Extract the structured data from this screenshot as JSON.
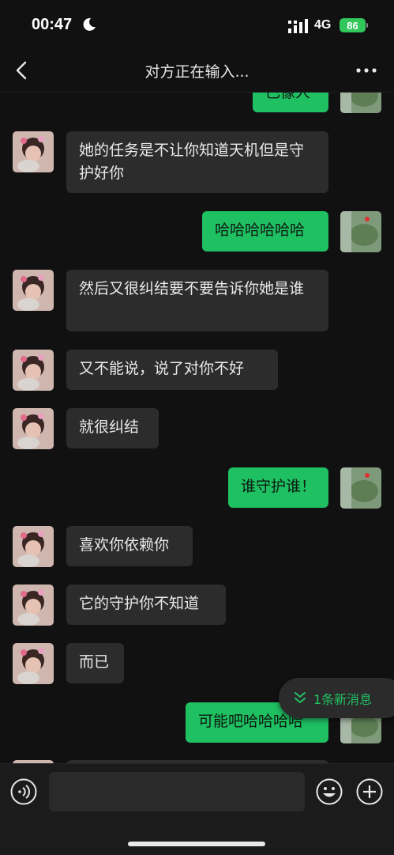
{
  "status": {
    "time": "00:47",
    "network": "4G",
    "battery": "86"
  },
  "nav": {
    "title": "对方正在输入..."
  },
  "messages": [
    {
      "dir": "out",
      "text": "已像人"
    },
    {
      "dir": "in",
      "text": "她的任务是不让你知道天机但是守护好你"
    },
    {
      "dir": "out",
      "text": "哈哈哈哈哈哈"
    },
    {
      "dir": "in",
      "text": "然后又很纠结要不要告诉你她是谁"
    },
    {
      "dir": "in",
      "text": "又不能说，说了对你不好"
    },
    {
      "dir": "in",
      "text": "就很纠结"
    },
    {
      "dir": "out",
      "text": "谁守护谁！"
    },
    {
      "dir": "in",
      "text": "喜欢你依赖你"
    },
    {
      "dir": "in",
      "text": "它的守护你不知道"
    },
    {
      "dir": "in",
      "text": "而已"
    },
    {
      "dir": "out",
      "text": "可能吧哈哈哈哈"
    }
  ],
  "new_messages_badge": "1条新消息",
  "input_bar": {
    "placeholder": ""
  },
  "icons": {
    "back": "chevron-left-icon",
    "more": "more-dots-icon",
    "voice": "voice-icon",
    "emoji": "emoji-icon",
    "plus": "plus-icon",
    "moon": "moon-icon",
    "signal": "signal-icon"
  },
  "colors": {
    "background": "#111111",
    "incoming_bubble": "#2c2c2c",
    "outgoing_bubble": "#1fc062",
    "accent": "#22c163"
  }
}
